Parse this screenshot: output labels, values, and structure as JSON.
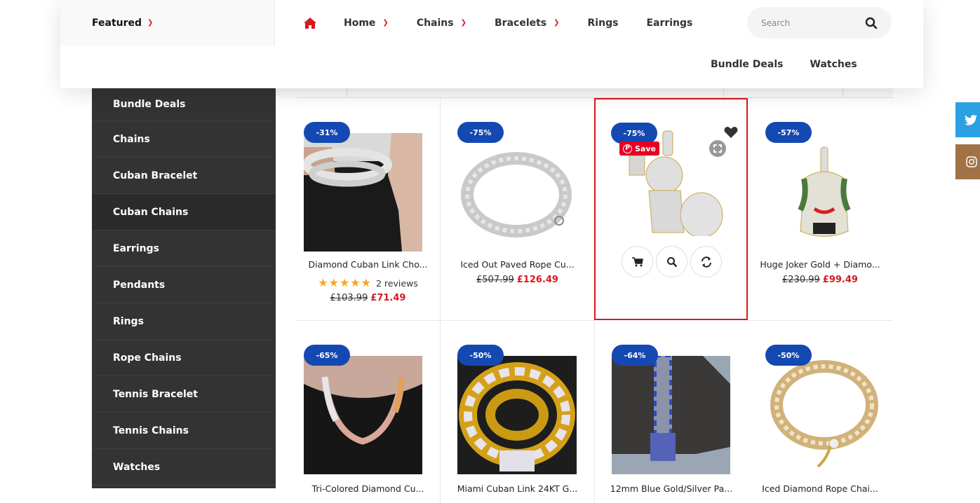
{
  "header": {
    "featured_label": "Featured",
    "nav": [
      {
        "label": "Home",
        "has_dropdown": true
      },
      {
        "label": "Chains",
        "has_dropdown": true
      },
      {
        "label": "Bracelets",
        "has_dropdown": true
      },
      {
        "label": "Rings",
        "has_dropdown": false
      },
      {
        "label": "Earrings",
        "has_dropdown": false
      }
    ],
    "nav_row2": [
      {
        "label": "Bundle Deals"
      },
      {
        "label": "Watches"
      }
    ],
    "search": {
      "placeholder": "Search",
      "value": ""
    },
    "home_icon": "home-icon",
    "search_icon": "search-icon"
  },
  "sidebar": {
    "items": [
      {
        "label": "Bundle Deals"
      },
      {
        "label": "Chains"
      },
      {
        "label": "Cuban Bracelet"
      },
      {
        "label": "Cuban Chains",
        "active": true
      },
      {
        "label": "Earrings"
      },
      {
        "label": "Pendants"
      },
      {
        "label": "Rings"
      },
      {
        "label": "Rope Chains"
      },
      {
        "label": "Tennis Bracelet"
      },
      {
        "label": "Tennis Chains"
      },
      {
        "label": "Watches"
      }
    ]
  },
  "products": [
    {
      "badge": "-31%",
      "title": "Diamond Cuban Link Cho...",
      "rating_stars": 5,
      "reviews": "2 reviews",
      "old_price": "£103.99",
      "new_price": "£71.49"
    },
    {
      "badge": "-75%",
      "title": "Iced Out Paved Rope Cu...",
      "old_price": "£507.99",
      "new_price": "£126.49"
    },
    {
      "badge": "-75%",
      "title": "",
      "hover": true,
      "pin_save": "Save",
      "actions": [
        "cart-icon",
        "search-icon",
        "compare-icon"
      ]
    },
    {
      "badge": "-57%",
      "title": "Huge Joker Gold + Diamo...",
      "old_price": "£230.99",
      "new_price": "£99.49"
    },
    {
      "badge": "-65%",
      "title": "Tri-Colored Diamond Cu..."
    },
    {
      "badge": "-50%",
      "title": "Miami Cuban Link 24KT G..."
    },
    {
      "badge": "-64%",
      "title": "12mm Blue Gold/Silver Pa..."
    },
    {
      "badge": "-50%",
      "title": "Iced Diamond Rope Chai..."
    }
  ],
  "social": [
    "twitter-icon",
    "instagram-icon"
  ],
  "colors": {
    "accent": "#d71920",
    "badge": "#1549b2",
    "sidebar": "#333333",
    "star": "#f5a623",
    "twitter": "#2ba1e4",
    "instagram": "#a07245",
    "pinterest": "#e60023"
  }
}
